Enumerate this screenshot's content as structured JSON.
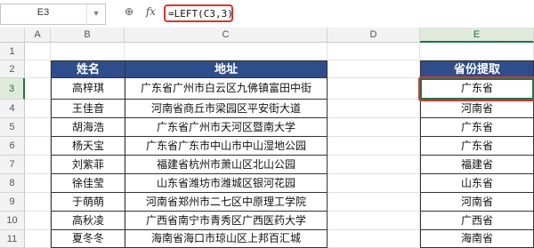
{
  "formula_bar": {
    "name_box": "E3",
    "name_box_dropdown_icon": "chevron-down-icon",
    "zoom_icon": "magnifier-icon",
    "fx_label": "fx",
    "formula": "=LEFT(C3,3)"
  },
  "columns": [
    "A",
    "B",
    "C",
    "D",
    "E"
  ],
  "rows": [
    "1",
    "2",
    "3",
    "4",
    "5",
    "6",
    "7",
    "8",
    "9",
    "10",
    "11"
  ],
  "table": {
    "headers": {
      "name": "姓名",
      "address": "地址",
      "province": "省份提取"
    },
    "records": [
      {
        "name": "高梓琪",
        "address": "广东省广州市白云区九佛镇富田中街",
        "province": "广东省"
      },
      {
        "name": "王佳音",
        "address": "河南省商丘市梁园区平安街大道",
        "province": "河南省"
      },
      {
        "name": "胡海浩",
        "address": "广东省广州市天河区暨南大学",
        "province": "广东省"
      },
      {
        "name": "杨天宝",
        "address": "广东省广东市中山市中山湿地公园",
        "province": "广东省"
      },
      {
        "name": "刘紫菲",
        "address": "福建省杭州市萧山区北山公园",
        "province": "福建省"
      },
      {
        "name": "徐佳莹",
        "address": "山东省潍坊市潍城区银河花园",
        "province": "山东省"
      },
      {
        "name": "于萌萌",
        "address": "河南省郑州市二七区中原理工学院",
        "province": "河南省"
      },
      {
        "name": "高秋凌",
        "address": "广西省南宁市青秀区广西医药大学",
        "province": "广西省"
      },
      {
        "name": "夏冬冬",
        "address": "海南省海口市琼山区上邦百汇城",
        "province": "海南省"
      }
    ]
  },
  "colors": {
    "header_fill": "#2f4d8a",
    "selection": "#217346",
    "highlight": "#e03131"
  }
}
